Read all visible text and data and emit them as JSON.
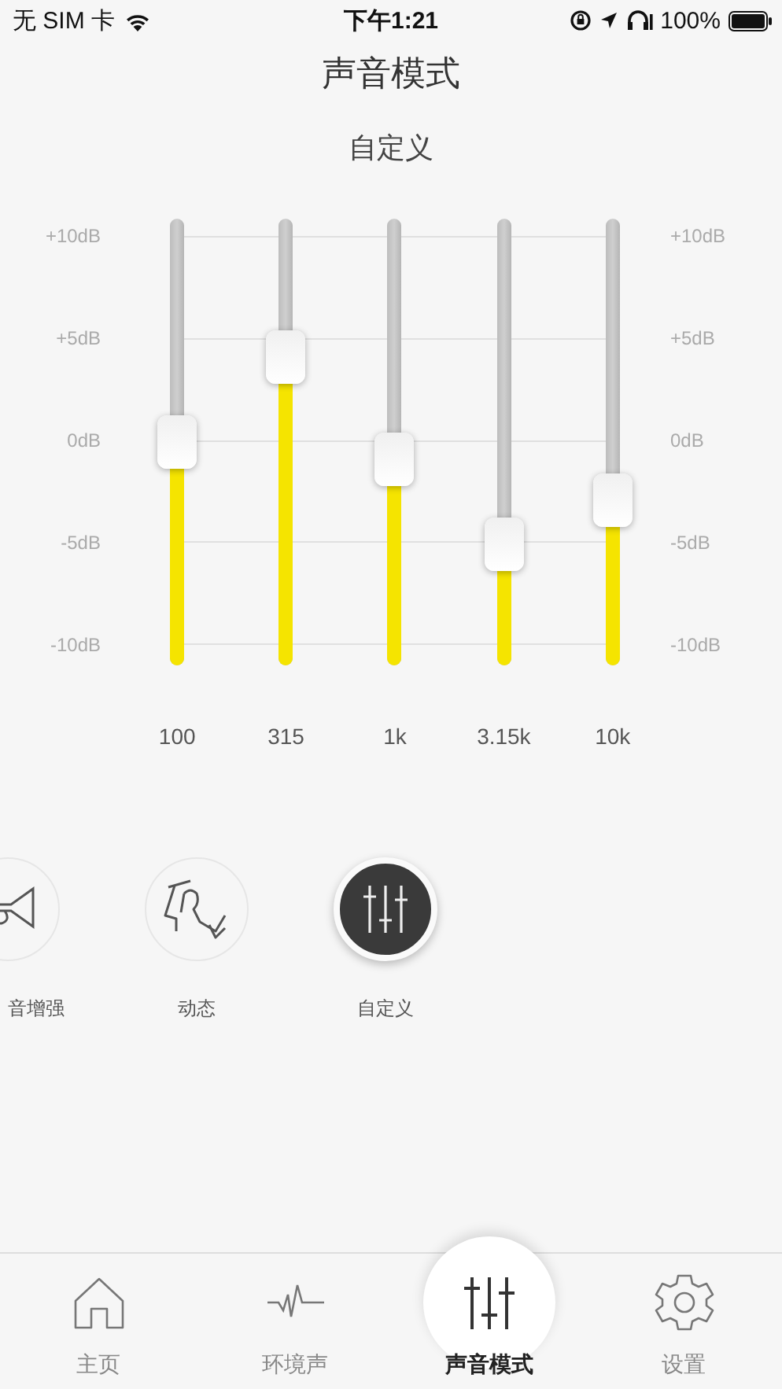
{
  "status_bar": {
    "carrier": "无 SIM 卡",
    "time": "下午1:21",
    "battery": "100%"
  },
  "title": "声音模式",
  "preset_name": "自定义",
  "eq": {
    "scale_left": [
      "+10dB",
      "+5dB",
      "0dB",
      "-5dB",
      "-10dB"
    ],
    "scale_right": [
      "+10dB",
      "+5dB",
      "0dB",
      "-5dB",
      "-10dB"
    ],
    "bands": [
      {
        "label": "100",
        "level": 0.5
      },
      {
        "label": "315",
        "level": 0.69
      },
      {
        "label": "1k",
        "level": 0.46
      },
      {
        "label": "3.15k",
        "level": 0.27
      },
      {
        "label": "10k",
        "level": 0.37
      }
    ]
  },
  "modes": [
    {
      "label": "音增强",
      "kind": "trumpet",
      "selected": false
    },
    {
      "label": "动态",
      "kind": "dancer",
      "selected": false
    },
    {
      "label": "自定义",
      "kind": "sliders",
      "selected": true
    }
  ],
  "tabs": [
    {
      "label": "主页",
      "kind": "home",
      "selected": false
    },
    {
      "label": "环境声",
      "kind": "pulse",
      "selected": false
    },
    {
      "label": "声音模式",
      "kind": "sliders",
      "selected": true
    },
    {
      "label": "设置",
      "kind": "gear",
      "selected": false
    }
  ]
}
